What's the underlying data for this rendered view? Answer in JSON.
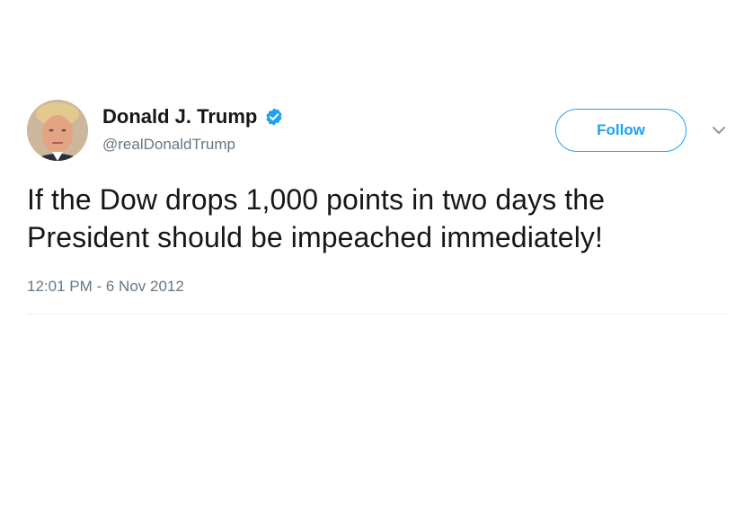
{
  "tweet": {
    "display_name": "Donald J. Trump",
    "handle": "@realDonaldTrump",
    "follow_label": "Follow",
    "text_line1": "If the Dow drops 1,000 points in two days the",
    "text_line2": "President should be impeached immediately!",
    "timestamp": "12:01 PM - 6 Nov 2012"
  },
  "colors": {
    "accent": "#1da1f2",
    "text_primary": "#14171a",
    "text_secondary": "#657786"
  },
  "icons": {
    "verified": "verified-badge-icon",
    "menu": "chevron-down-icon"
  }
}
